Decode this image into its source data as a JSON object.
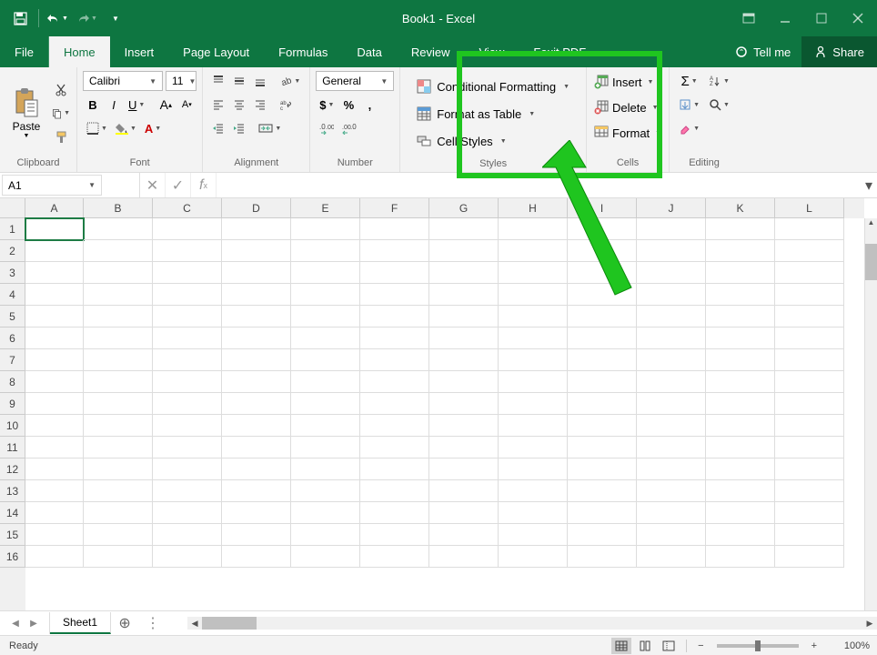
{
  "title": "Book1 - Excel",
  "qat": {
    "save": "save",
    "undo": "undo",
    "redo": "redo",
    "custom": "custom"
  },
  "tabs": [
    "File",
    "Home",
    "Insert",
    "Page Layout",
    "Formulas",
    "Data",
    "Review",
    "View",
    "Foxit PDF"
  ],
  "active_tab": "Home",
  "tellme": "Tell me",
  "share": "Share",
  "ribbon": {
    "clipboard": {
      "label": "Clipboard",
      "paste": "Paste"
    },
    "font": {
      "label": "Font",
      "name": "Calibri",
      "size": "11"
    },
    "alignment": {
      "label": "Alignment"
    },
    "number": {
      "label": "Number",
      "format": "General"
    },
    "styles": {
      "label": "Styles",
      "conditional": "Conditional Formatting",
      "table": "Format as Table",
      "cell": "Cell Styles"
    },
    "cells": {
      "label": "Cells",
      "insert": "Insert",
      "delete": "Delete",
      "format": "Format"
    },
    "editing": {
      "label": "Editing"
    }
  },
  "namebox": "A1",
  "columns": [
    "A",
    "B",
    "C",
    "D",
    "E",
    "F",
    "G",
    "H",
    "I",
    "J",
    "K",
    "L"
  ],
  "rows": [
    "1",
    "2",
    "3",
    "4",
    "5",
    "6",
    "7",
    "8",
    "9",
    "10",
    "11",
    "12",
    "13",
    "14",
    "15",
    "16"
  ],
  "sheet_tab": "Sheet1",
  "status": "Ready",
  "zoom": "100%"
}
